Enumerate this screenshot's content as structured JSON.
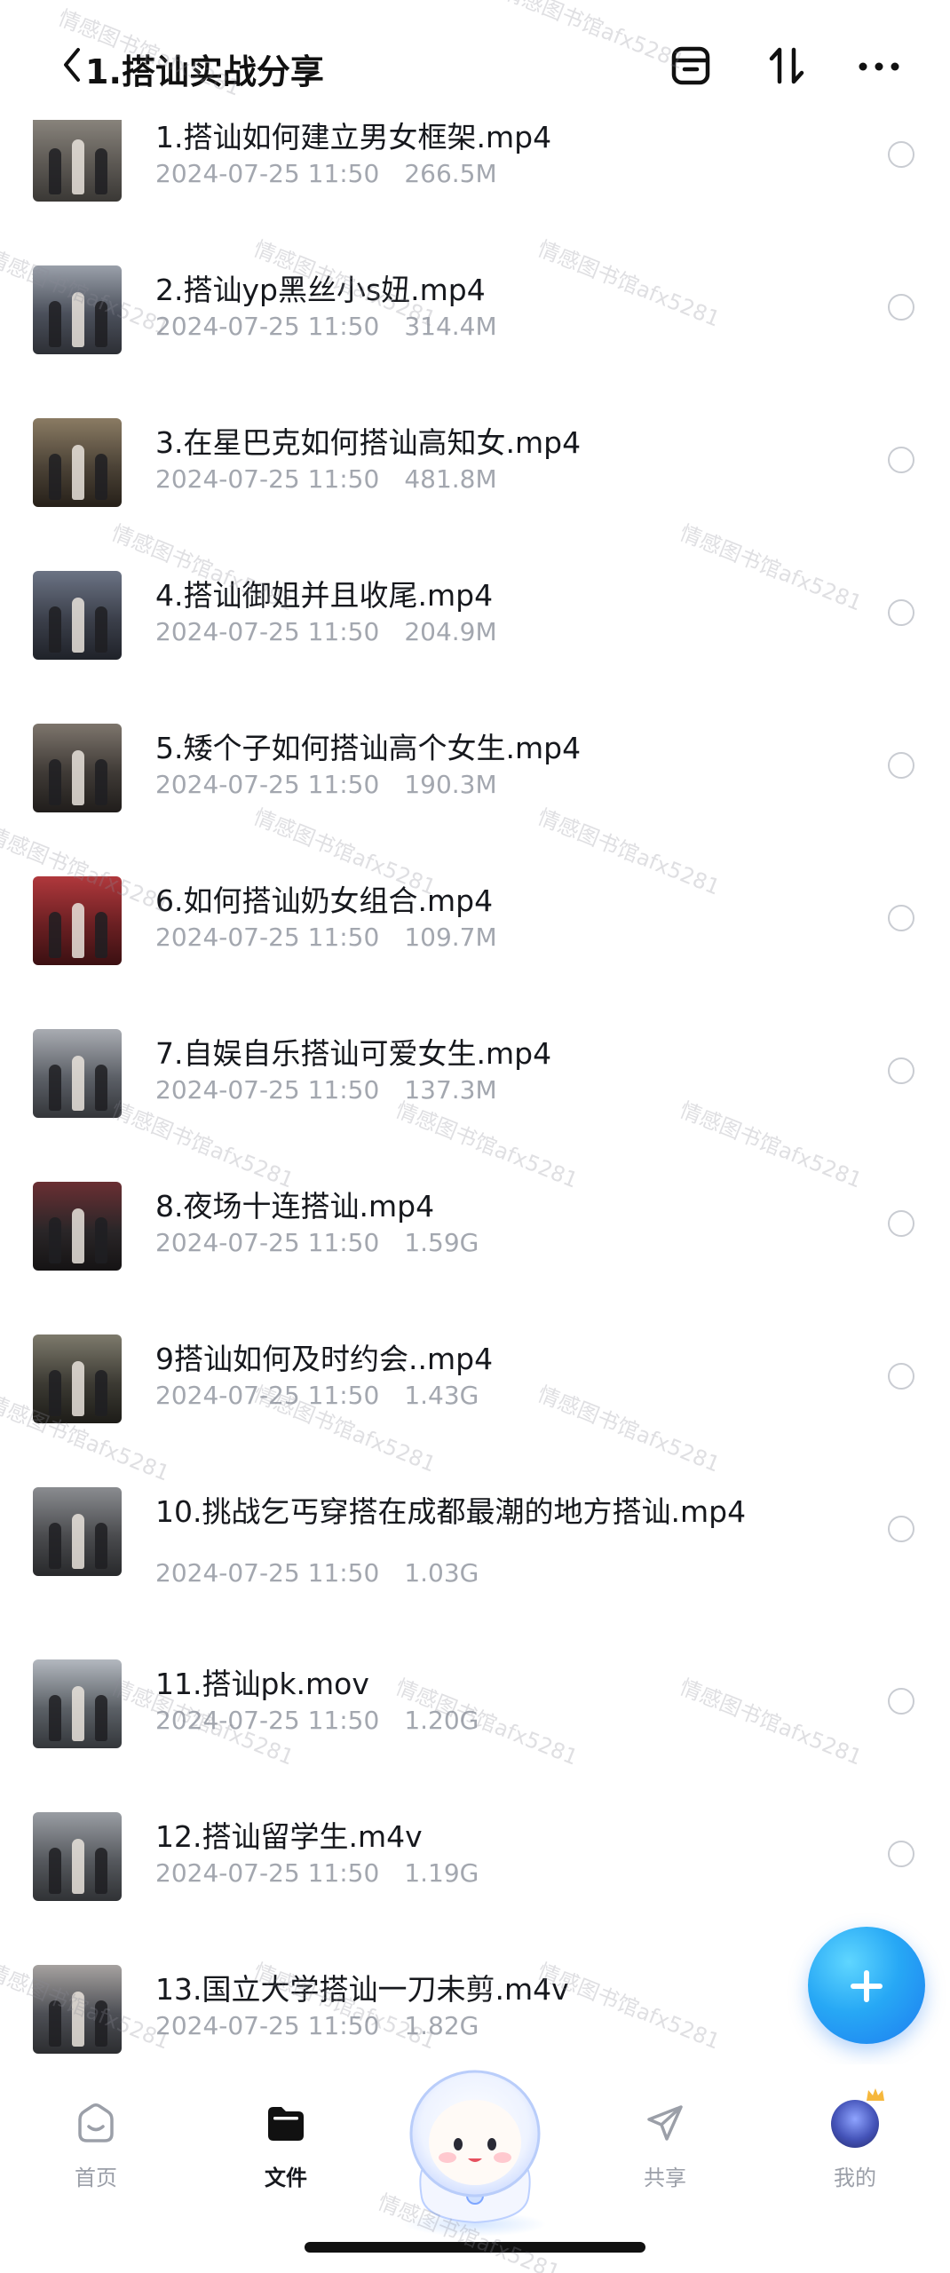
{
  "header": {
    "title": "1.搭讪实战分享",
    "icons": [
      "back-chevron-icon",
      "archive-box-icon",
      "sort-icon",
      "more-icon"
    ]
  },
  "files": [
    {
      "name": "1.搭讪如何建立男女框架.mp4",
      "date": "2024-07-25 11:50",
      "size": "266.5M"
    },
    {
      "name": "2.搭讪yp黑丝小s妞.mp4",
      "date": "2024-07-25 11:50",
      "size": "314.4M"
    },
    {
      "name": "3.在星巴克如何搭讪高知女.mp4",
      "date": "2024-07-25 11:50",
      "size": "481.8M"
    },
    {
      "name": "4.搭讪御姐并且收尾.mp4",
      "date": "2024-07-25 11:50",
      "size": "204.9M"
    },
    {
      "name": "5.矮个子如何搭讪高个女生.mp4",
      "date": "2024-07-25 11:50",
      "size": "190.3M"
    },
    {
      "name": "6.如何搭讪奶女组合.mp4",
      "date": "2024-07-25 11:50",
      "size": "109.7M"
    },
    {
      "name": "7.自娱自乐搭讪可爱女生.mp4",
      "date": "2024-07-25 11:50",
      "size": "137.3M"
    },
    {
      "name": "8.夜场十连搭讪.mp4",
      "date": "2024-07-25 11:50",
      "size": "1.59G"
    },
    {
      "name": "9搭讪如何及时约会..mp4",
      "date": "2024-07-25 11:50",
      "size": "1.43G"
    },
    {
      "name": "10.挑战乞丐穿搭在成都最潮的地方搭讪.mp4",
      "date": "2024-07-25 11:50",
      "size": "1.03G"
    },
    {
      "name": "11.搭讪pk.mov",
      "date": "2024-07-25 11:50",
      "size": "1.20G"
    },
    {
      "name": "12.搭讪留学生.m4v",
      "date": "2024-07-25 11:50",
      "size": "1.19G"
    },
    {
      "name": "13.国立大学搭讪一刀未剪.m4v",
      "date": "2024-07-25 11:50",
      "size": "1.82G"
    }
  ],
  "fab": {
    "icon": "plus-icon"
  },
  "nav": {
    "home": "首页",
    "files": "文件",
    "share": "共享",
    "mine": "我的"
  },
  "watermark": "情感图书馆afx5281",
  "colors": {
    "accent": "#1d7cf0",
    "text": "#16181d",
    "meta": "#a3a7af"
  }
}
